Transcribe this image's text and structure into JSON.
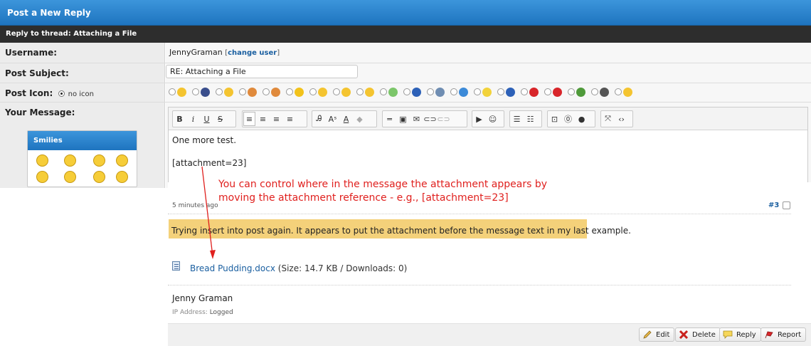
{
  "header": {
    "title": "Post a New Reply"
  },
  "thread_bar": {
    "text": "Reply to thread: Attaching a File"
  },
  "form": {
    "username_label": "Username:",
    "username_value": "JennyGraman",
    "change_user_open": "[",
    "change_user_link": "change user",
    "change_user_close": "]",
    "subject_label": "Post Subject:",
    "subject_value": "RE: Attaching a File",
    "icon_label": "Post Icon:",
    "no_icon_label": "no icon",
    "message_label": "Your Message:"
  },
  "post_icons": [
    {
      "name": "smile-icon",
      "color": "#f4c430"
    },
    {
      "name": "floppy-icon",
      "color": "#3a4e8c"
    },
    {
      "name": "grin-icon",
      "color": "#f4c430"
    },
    {
      "name": "thumbs-up-icon",
      "color": "#e08a3c"
    },
    {
      "name": "thumbs-down-icon",
      "color": "#e08a3c"
    },
    {
      "name": "star-icon",
      "color": "#f2c21a"
    },
    {
      "name": "unsure-icon",
      "color": "#f4c430"
    },
    {
      "name": "angry-icon",
      "color": "#f4c430"
    },
    {
      "name": "smile2-icon",
      "color": "#f4c430"
    },
    {
      "name": "rainbow-icon",
      "color": "#7cc66a"
    },
    {
      "name": "question-icon",
      "color": "#2d61b8"
    },
    {
      "name": "image-icon",
      "color": "#6f8db2"
    },
    {
      "name": "music-icon",
      "color": "#3c8ad8"
    },
    {
      "name": "lightbulb-icon",
      "color": "#f2d23a"
    },
    {
      "name": "info-icon",
      "color": "#2d61b8"
    },
    {
      "name": "heart-icon",
      "color": "#d8252a"
    },
    {
      "name": "exclamation-icon",
      "color": "#d8252a"
    },
    {
      "name": "bug-icon",
      "color": "#4f9a3a"
    },
    {
      "name": "film-icon",
      "color": "#555555"
    },
    {
      "name": "laugh-icon",
      "color": "#f4c430"
    }
  ],
  "editor": {
    "line1": "One more test.",
    "line2": "[attachment=23]"
  },
  "smilies": {
    "title": "Smilies"
  },
  "annotation": {
    "line1": "You can control where in the message the attachment appears by",
    "line2": "moving the attachment reference - e.g., [attachment=23]"
  },
  "post": {
    "time": "5 minutes ago",
    "number": "#3",
    "message": "Trying insert into post again.  It appears to put the attachment before the message text in my last example.",
    "attachment_name": "Bread Pudding.docx",
    "attachment_info": " (Size: 14.7 KB / Downloads: 0)",
    "author": "Jenny Graman",
    "ip_label": "IP Address:",
    "ip_value": " Logged",
    "buttons": {
      "edit": "Edit",
      "delete": "Delete",
      "reply": "Reply",
      "report": "Report"
    }
  },
  "colors": {
    "header_blue": "#1e74bf",
    "highlight": "#f4d17a",
    "annotation_red": "#e0201e",
    "link_blue": "#1a5fa0"
  }
}
